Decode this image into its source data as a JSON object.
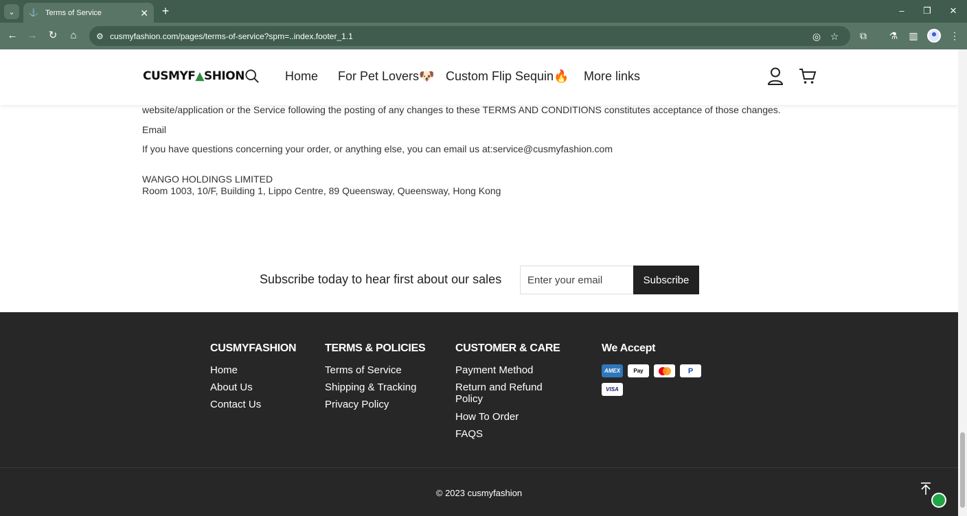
{
  "browser": {
    "tab_title": "Terms of Service",
    "url": "cusmyfashion.com/pages/terms-of-service?spm=..index.footer_1.1"
  },
  "header": {
    "logo_text": "CUSMYF",
    "logo_text_end": "SHION",
    "menu": [
      "Home",
      "For Pet Lovers🐶",
      "Custom Flip Sequin🔥",
      "More links"
    ]
  },
  "content": {
    "line1": "website/application or the Service following the posting of any changes to these TERMS AND CONDITIONS constitutes acceptance of those changes.",
    "email_heading": "Email",
    "email_text": "If you have questions concerning your order, or anything else, you can email us at:service@cusmyfashion.com",
    "company": "WANGO HOLDINGS LIMITED",
    "address": "Room 1003, 10/F, Building 1, Lippo Centre, 89 Queensway, Queensway, Hong Kong"
  },
  "subscribe": {
    "text": "Subscribe today to hear first about our sales",
    "placeholder": "Enter your email",
    "button": "Subscribe"
  },
  "footer": {
    "col1": {
      "title": "CUSMYFASHION",
      "links": [
        "Home",
        "About Us",
        "Contact Us"
      ]
    },
    "col2": {
      "title": "TERMS & POLICIES",
      "links": [
        "Terms of Service",
        "Shipping & Tracking",
        "Privacy Policy"
      ]
    },
    "col3": {
      "title": "CUSTOMER & CARE",
      "links": [
        "Payment Method",
        "Return and Refund",
        "Policy",
        "How To Order",
        "FAQS"
      ]
    },
    "col4": {
      "title": "We Accept",
      "payments": [
        "AMEX",
        "Pay",
        "",
        "P",
        "VISA"
      ]
    },
    "copyright": "© 2023 cusmyfashion"
  },
  "colors": {
    "chrome": "#3f5c4e",
    "toolbar": "#587566",
    "footer_bg": "#272727",
    "button_bg": "#222222"
  }
}
